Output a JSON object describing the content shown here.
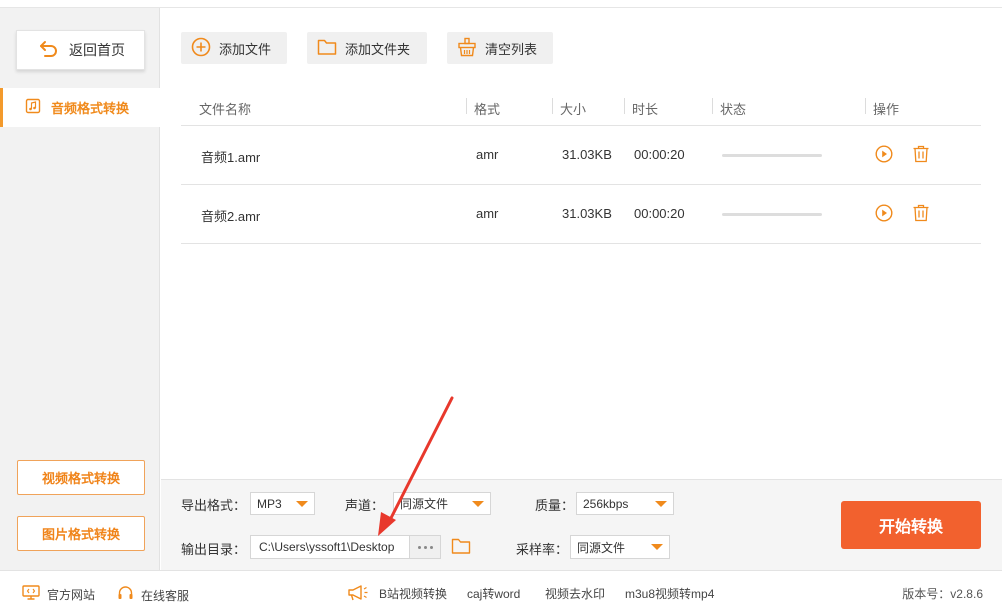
{
  "colors": {
    "accent": "#f39a2c",
    "accent_text": "#f08a1c",
    "start_button": "#f2612e",
    "arrow": "#e8382c"
  },
  "sidebar": {
    "home_label": "返回首页",
    "active_item": "音频格式转换",
    "bottom_buttons": [
      "视频格式转换",
      "图片格式转换"
    ]
  },
  "toolbar": {
    "add_file": "添加文件",
    "add_folder": "添加文件夹",
    "clear_list": "清空列表"
  },
  "table": {
    "headers": [
      "文件名称",
      "格式",
      "大小",
      "时长",
      "状态",
      "操作"
    ],
    "rows": [
      {
        "name": "音频1.amr",
        "format": "amr",
        "size": "31.03KB",
        "duration": "00:00:20",
        "progress": 0
      },
      {
        "name": "音频2.amr",
        "format": "amr",
        "size": "31.03KB",
        "duration": "00:00:20",
        "progress": 0
      }
    ]
  },
  "settings": {
    "export_format_label": "导出格式：",
    "export_format_value": "MP3",
    "channel_label": "声道：",
    "channel_value": "同源文件",
    "quality_label": "质量：",
    "quality_value": "256kbps",
    "output_dir_label": "输出目录：",
    "output_dir_value": "C:\\Users\\yssoft1\\Desktop",
    "sample_rate_label": "采样率：",
    "sample_rate_value": "同源文件",
    "start_label": "开始转换"
  },
  "footer": {
    "website": "官方网站",
    "support": "在线客服",
    "links": [
      "B站视频转换",
      "caj转word",
      "视频去水印",
      "m3u8视频转mp4"
    ],
    "version": "版本号：v2.8.6"
  }
}
